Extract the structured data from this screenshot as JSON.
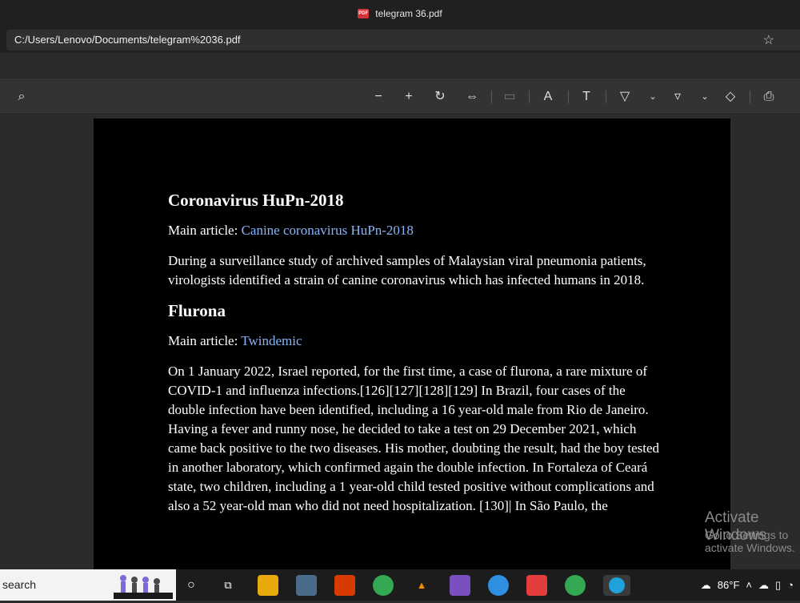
{
  "window": {
    "title": "telegram 36.pdf"
  },
  "address": {
    "url": "C:/Users/Lenovo/Documents/telegram%2036.pdf"
  },
  "toolbar": {
    "icons": [
      "search-icon",
      "zoom-out-icon",
      "zoom-in-icon",
      "rotate-icon",
      "fit-width-icon",
      "page-view-icon",
      "read-aloud-icon",
      "text-box-icon",
      "draw-icon",
      "highlight-icon",
      "erase-icon",
      "print-icon"
    ]
  },
  "document": {
    "h1": "Coronavirus HuPn-2018",
    "main1_prefix": "Main article: ",
    "main1_link": "Canine coronavirus HuPn-2018",
    "para1": "During a surveillance study of archived samples of Malaysian viral pneumonia patients, virologists identified a strain of canine coronavirus which has infected humans in 2018.",
    "h2": "Flurona",
    "main2_prefix": "Main article: ",
    "main2_link": "Twindemic",
    "para2": "On 1 January 2022, Israel reported, for the first time, a case of flurona, a rare mixture of COVID-1 and influenza infections.[126][127][128][129] In Brazil, four cases of the double infection have been identified, including a 16 year-old male from Rio de Janeiro. Having a fever and runny nose, he decided to take a test on 29 December 2021, which came back positive to the two diseases. His mother, doubting the result, had the boy tested in another laboratory, which confirmed again the double infection. In Fortaleza of Ceará state, two children, including a 1 year-old child tested positive without complications and also a 52 year-old man who did not need hospitalization. [130]| In São Paulo, the"
  },
  "watermark": {
    "line1": "Activate Windows",
    "line2": "Go to Settings to activate Windows."
  },
  "taskbar": {
    "search_text": "search",
    "temperature": "86°F"
  },
  "colors": {
    "accent_link": "#8ab4f8",
    "page_bg": "#000000",
    "chrome_bg": "#202020"
  }
}
